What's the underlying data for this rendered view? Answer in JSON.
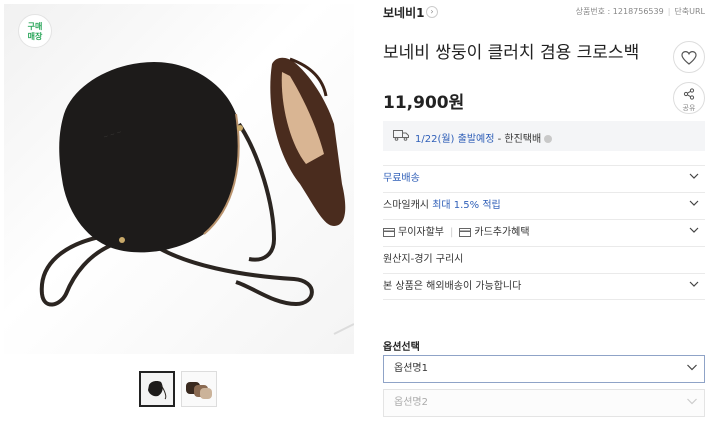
{
  "badge": {
    "line1": "구매",
    "line2": "매장"
  },
  "store": {
    "name": "보네비1",
    "product_no_label": "상품번호 : 1218756539",
    "short_url_label": "단축URL"
  },
  "product": {
    "title": "보네비 쌍둥이 클러치 겸용 크로스백",
    "price": "11,900원"
  },
  "actions": {
    "share_label": "공유"
  },
  "shipping": {
    "date": "1/22(월) 출발예정",
    "courier": " - 한진택배"
  },
  "rows": {
    "free_shipping": "무료배송",
    "smile_cash_prefix": "스마일캐시 ",
    "smile_cash_rate": "최대 1.5% 적립",
    "installment": "무이자할부",
    "card_benefit": "카드추가혜택",
    "origin": "원산지-경기 구리시",
    "overseas": "본 상품은 해외배송이 가능합니다"
  },
  "options": {
    "label": "옵션선택",
    "select1": "옵션명1",
    "select2": "옵션명2"
  },
  "colors": {
    "accent": "#2f5fb8",
    "green": "#2aa65a"
  }
}
